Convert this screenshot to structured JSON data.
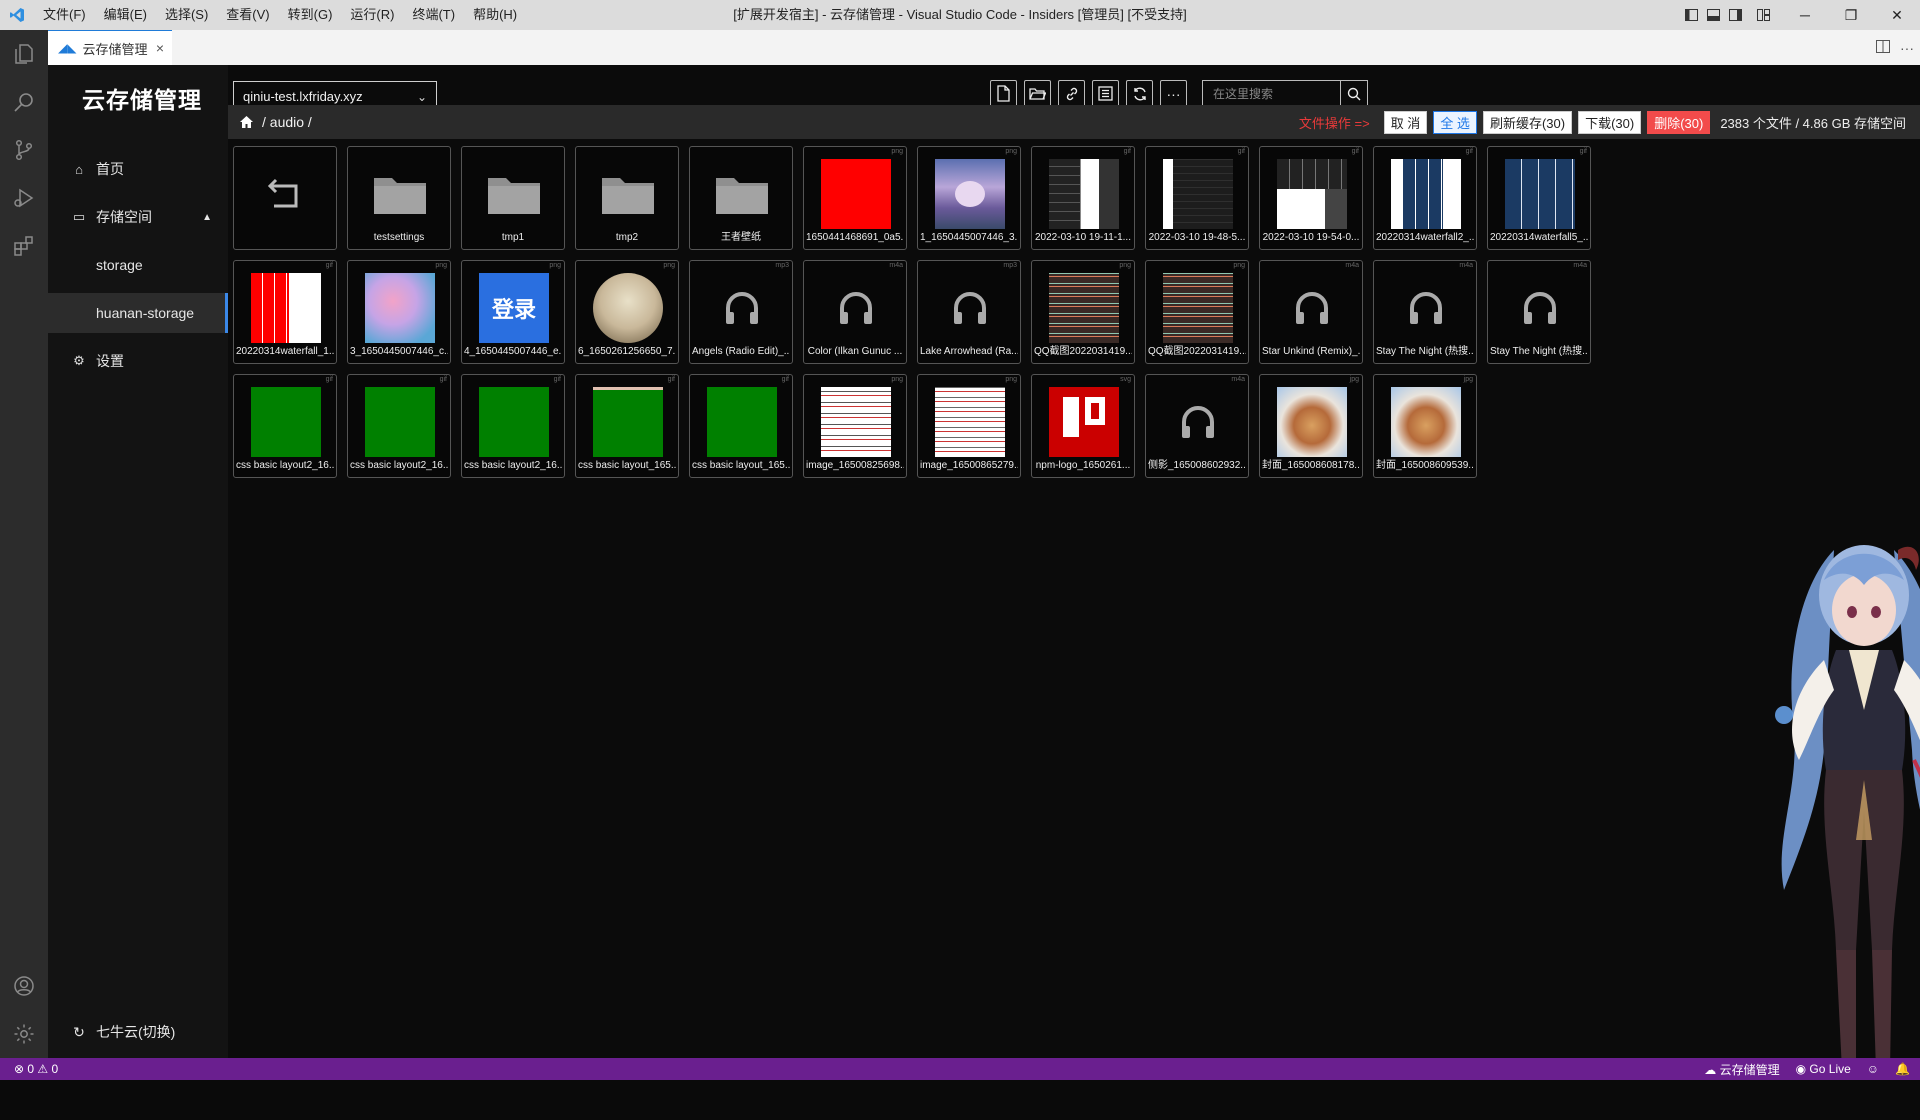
{
  "menu": [
    "文件(F)",
    "编辑(E)",
    "选择(S)",
    "查看(V)",
    "转到(G)",
    "运行(R)",
    "终端(T)",
    "帮助(H)"
  ],
  "window_title": "[扩展开发宿主] - 云存储管理 - Visual Studio Code - Insiders [管理员] [不受支持]",
  "tab": {
    "label": "云存储管理",
    "close": "×"
  },
  "app": {
    "title": "云存储管理",
    "nav": {
      "home": "首页",
      "storage_space": "存储空间",
      "bucket1": "storage",
      "bucket2": "huanan-storage",
      "settings": "设置",
      "switch": "七牛云(切换)"
    }
  },
  "bucket_select": {
    "value": "qiniu-test.lxfriday.xyz"
  },
  "search": {
    "placeholder": "在这里搜索"
  },
  "path": {
    "crumb": "/ audio /"
  },
  "ops": {
    "hint": "文件操作 =>",
    "cancel": "取 消",
    "select_all": "全 选",
    "refresh_cache": "刷新缓存(30)",
    "download": "下载(30)",
    "delete": "删除(30)",
    "summary": "2383 个文件 / 4.86 GB 存储空间"
  },
  "colors": {
    "statusbar": "#6a1f8f",
    "accent": "#1f78e8",
    "danger": "#f24b4b",
    "nav_active": "#2c2c2c"
  },
  "files": [
    {
      "name": "",
      "ext": "",
      "kind": "back"
    },
    {
      "name": "testsettings",
      "ext": "",
      "kind": "folder"
    },
    {
      "name": "tmp1",
      "ext": "",
      "kind": "folder"
    },
    {
      "name": "tmp2",
      "ext": "",
      "kind": "folder"
    },
    {
      "name": "王者壁纸",
      "ext": "",
      "kind": "folder"
    },
    {
      "name": "1650441468691_0a5...",
      "ext": "png",
      "kind": "red"
    },
    {
      "name": "1_1650445007446_3...",
      "ext": "png",
      "kind": "game"
    },
    {
      "name": "2022-03-10 19-11-1...",
      "ext": "gif",
      "kind": "screen1"
    },
    {
      "name": "2022-03-10 19-48-5...",
      "ext": "gif",
      "kind": "screen2"
    },
    {
      "name": "2022-03-10 19-54-0...",
      "ext": "gif",
      "kind": "screen3"
    },
    {
      "name": "20220314waterfall2_...",
      "ext": "gif",
      "kind": "waterfall"
    },
    {
      "name": "20220314waterfall5_...",
      "ext": "gif",
      "kind": "waterfall2"
    },
    {
      "name": "20220314waterfall_1...",
      "ext": "gif",
      "kind": "redwaterfall"
    },
    {
      "name": "3_1650445007446_c...",
      "ext": "png",
      "kind": "blur"
    },
    {
      "name": "4_1650445007446_e...",
      "ext": "png",
      "kind": "login"
    },
    {
      "name": "6_1650261256650_7...",
      "ext": "png",
      "kind": "photo"
    },
    {
      "name": "Angels (Radio Edit)_...",
      "ext": "mp3",
      "kind": "audio"
    },
    {
      "name": "Color (Ilkan Gunuc ...",
      "ext": "m4a",
      "kind": "audio"
    },
    {
      "name": "Lake Arrowhead (Ra...",
      "ext": "mp3",
      "kind": "audio"
    },
    {
      "name": "QQ截图2022031419...",
      "ext": "png",
      "kind": "code"
    },
    {
      "name": "QQ截图2022031419...",
      "ext": "png",
      "kind": "code"
    },
    {
      "name": "Star Unkind (Remix)_...",
      "ext": "m4a",
      "kind": "audio"
    },
    {
      "name": "Stay The Night (热搜...",
      "ext": "m4a",
      "kind": "audio"
    },
    {
      "name": "Stay The Night (热搜...",
      "ext": "m4a",
      "kind": "audio"
    },
    {
      "name": "css basic layout2_16...",
      "ext": "gif",
      "kind": "green"
    },
    {
      "name": "css basic layout2_16...",
      "ext": "gif",
      "kind": "green"
    },
    {
      "name": "css basic layout2_16...",
      "ext": "gif",
      "kind": "green"
    },
    {
      "name": "css basic layout_165...",
      "ext": "gif",
      "kind": "green2"
    },
    {
      "name": "css basic layout_165...",
      "ext": "gif",
      "kind": "green"
    },
    {
      "name": "image_16500825698...",
      "ext": "png",
      "kind": "doc"
    },
    {
      "name": "image_16500865279...",
      "ext": "png",
      "kind": "doc2"
    },
    {
      "name": "npm-logo_1650261...",
      "ext": "svg",
      "kind": "npm"
    },
    {
      "name": "侧影_165008602932...",
      "ext": "m4a",
      "kind": "audio"
    },
    {
      "name": "封面_165008608178...",
      "ext": "jpg",
      "kind": "food"
    },
    {
      "name": "封面_165008609539...",
      "ext": "jpg",
      "kind": "food"
    }
  ],
  "status": {
    "problems": "⊗ 0 ⚠ 0",
    "ext_name": "云存储管理",
    "golive": "Go Live"
  }
}
